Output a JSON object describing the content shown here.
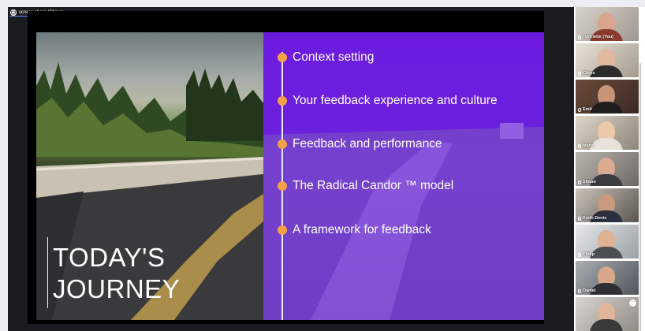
{
  "share": {
    "label": "screen share (Chrys)",
    "more": "···"
  },
  "slide": {
    "title_line1": "TODAY'S",
    "title_line2": "JOURNEY",
    "items": [
      "Context setting",
      "Your feedback experience and culture",
      "Feedback and performance",
      "The Radical Candor ™ model",
      "A framework for feedback"
    ],
    "accent": "#f2a14a",
    "panel_color": "#6d1bdf"
  },
  "participants": [
    {
      "name": "Henriette (You)",
      "active": false
    },
    {
      "name": "Chrys",
      "active": true
    },
    {
      "name": "Emil",
      "active": false
    },
    {
      "name": "Marie",
      "active": false
    },
    {
      "name": "Shaun",
      "active": false
    },
    {
      "name": "Keith Denis",
      "active": false
    },
    {
      "name": "Philip",
      "active": false
    },
    {
      "name": "Daniel",
      "active": false
    },
    {
      "name": "",
      "active": false,
      "more": "···"
    }
  ]
}
